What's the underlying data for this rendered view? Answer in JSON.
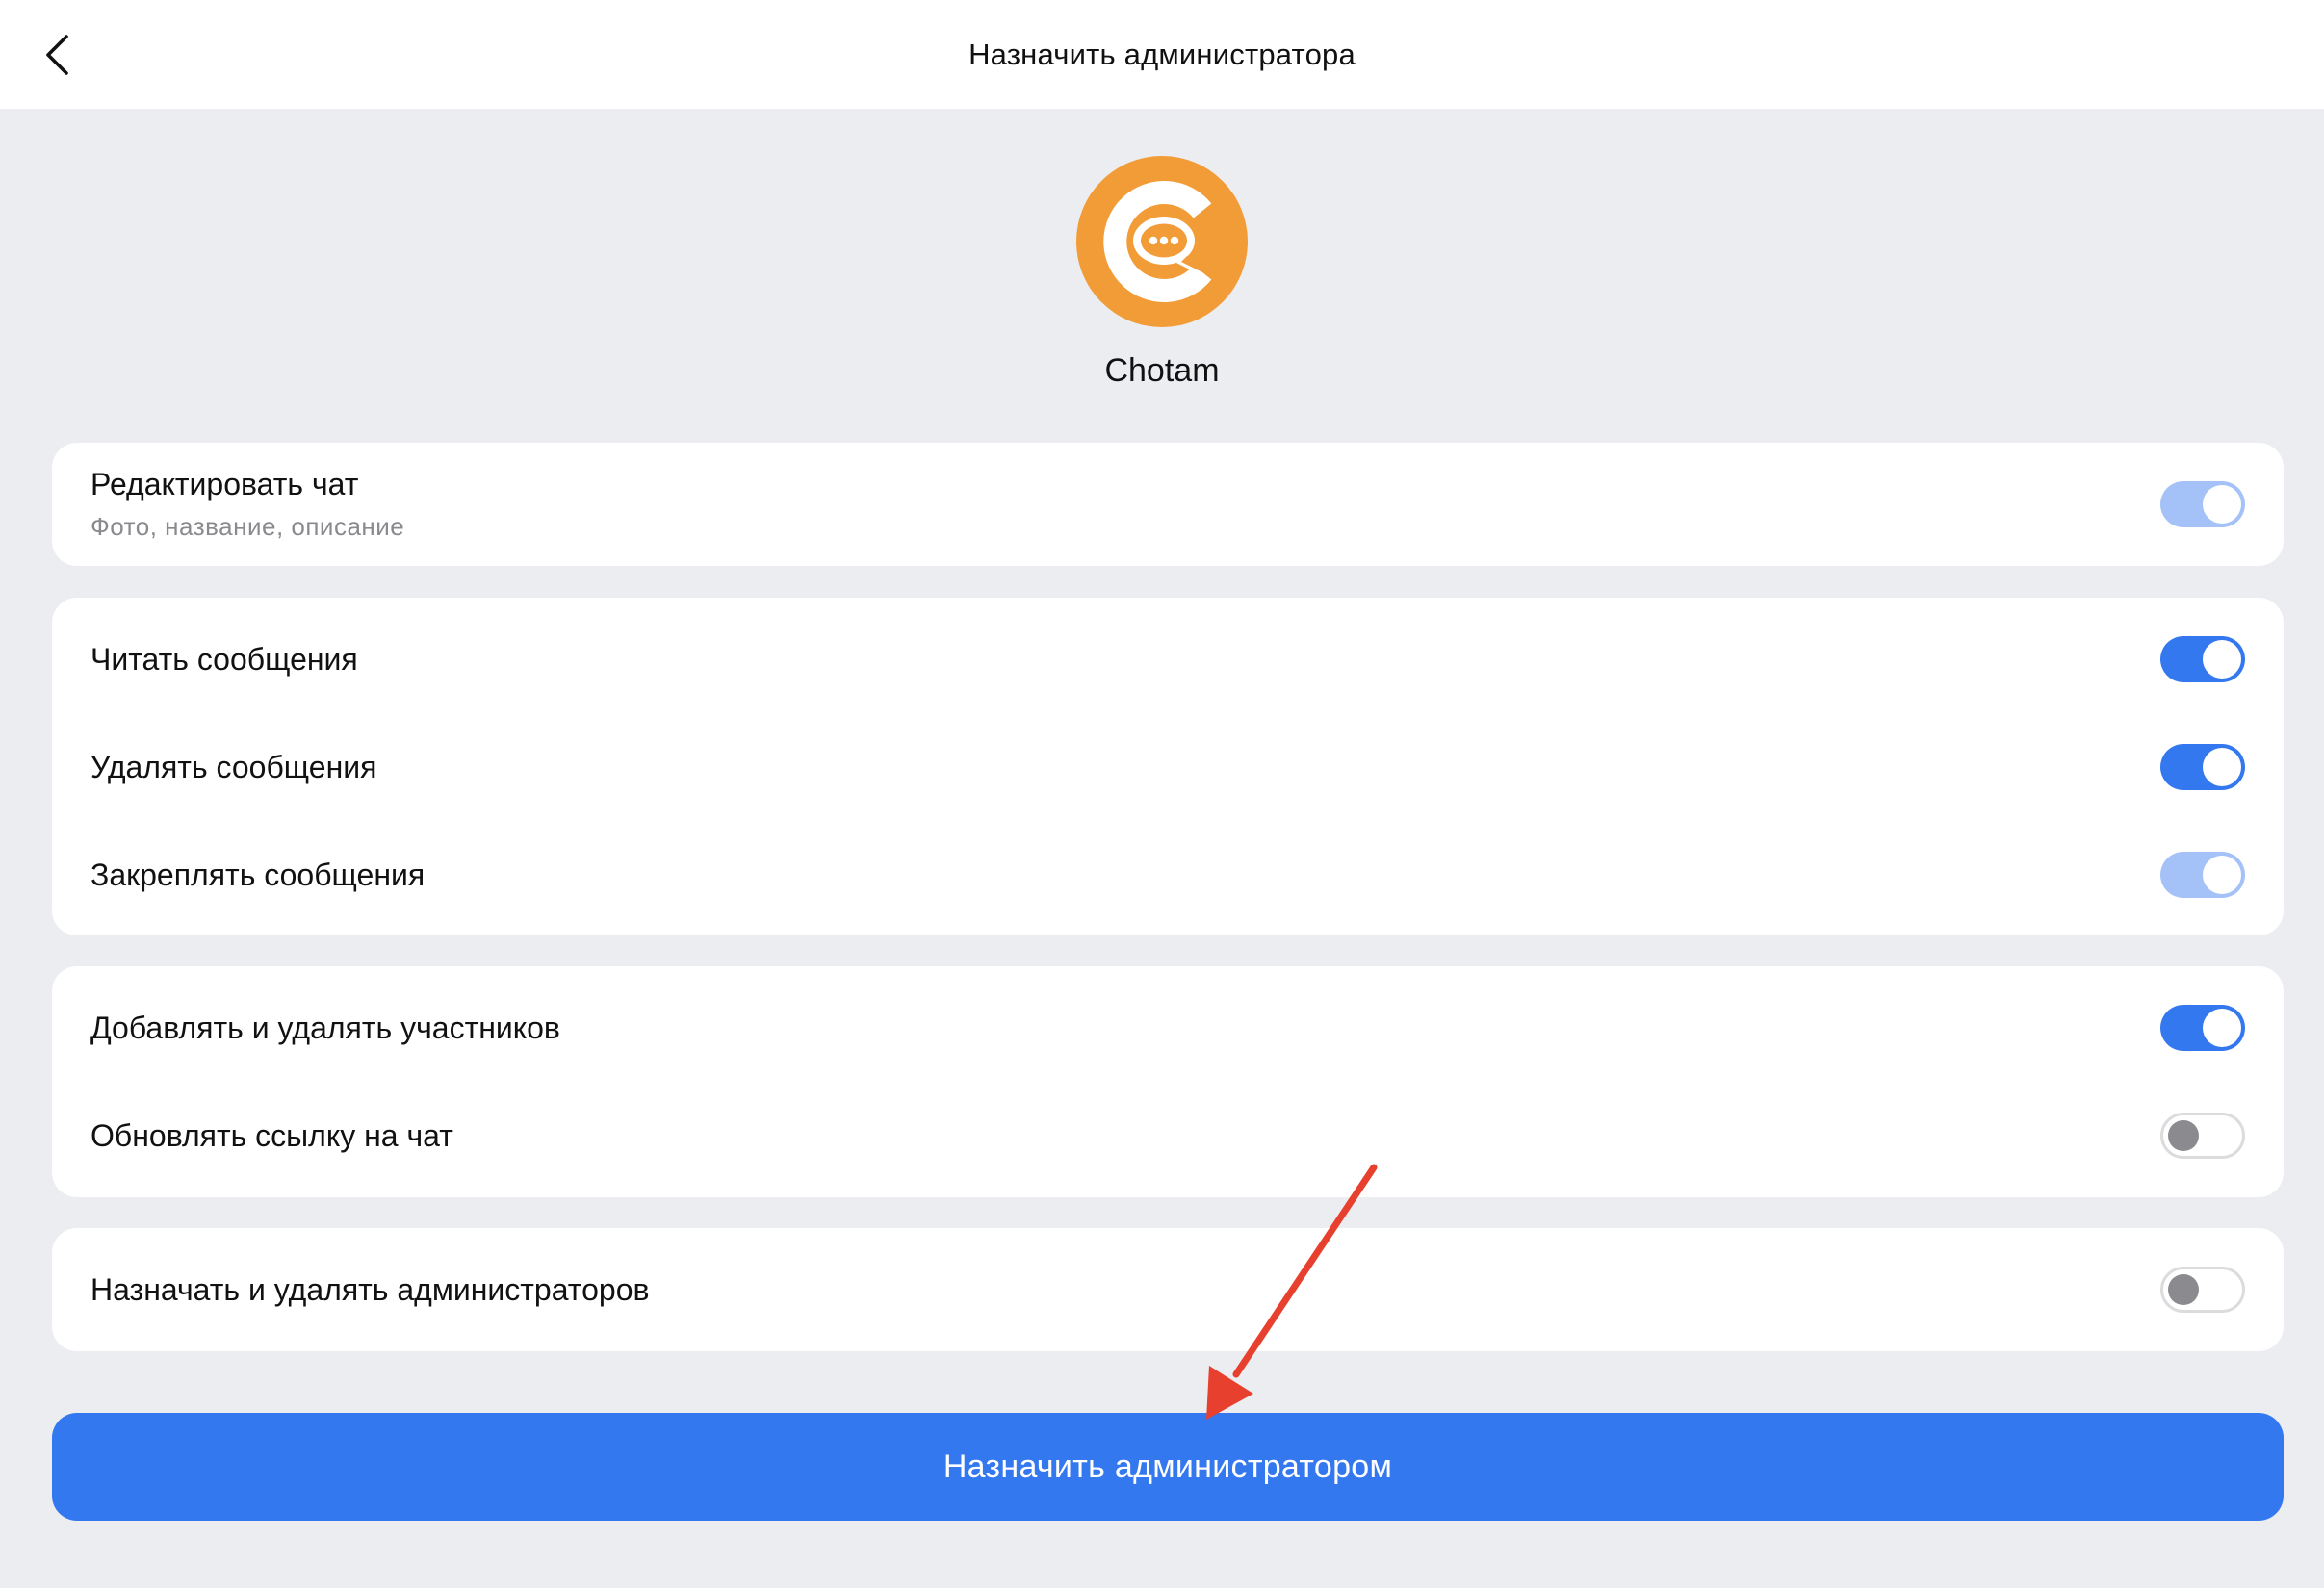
{
  "header": {
    "title": "Назначить администратора"
  },
  "profile": {
    "name": "Chotam",
    "avatar_color": "#f29c38"
  },
  "permissions": {
    "edit_chat": {
      "label": "Редактировать чат",
      "sub": "Фото, название, описание",
      "state": "on-disabled"
    },
    "read_messages": {
      "label": "Читать сообщения",
      "state": "on"
    },
    "delete_messages": {
      "label": "Удалять сообщения",
      "state": "on"
    },
    "pin_messages": {
      "label": "Закреплять сообщения",
      "state": "on-disabled"
    },
    "manage_members": {
      "label": "Добавлять и удалять участников",
      "state": "on"
    },
    "update_link": {
      "label": "Обновлять ссылку на чат",
      "state": "off"
    },
    "manage_admins": {
      "label": "Назначать и удалять администраторов",
      "state": "off"
    }
  },
  "actions": {
    "primary_label": "Назначить администратором"
  },
  "colors": {
    "accent": "#3478f0",
    "accent_disabled": "#a4c2f7",
    "background": "#ecedf1",
    "annotation": "#e8402f"
  }
}
